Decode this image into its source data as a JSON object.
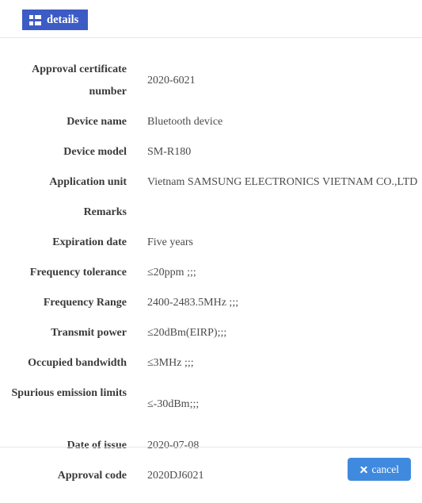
{
  "tab": {
    "label": "details",
    "icon": "grid-icon",
    "active_color": "#3c5bc4"
  },
  "form": {
    "rows": [
      {
        "label": "Approval certificate number",
        "value": "2020-6021",
        "wraps": true
      },
      {
        "label": "Device name",
        "value": "Bluetooth device",
        "wraps": false
      },
      {
        "label": "Device model",
        "value": "SM-R180",
        "wraps": false
      },
      {
        "label": "Application unit",
        "value": "Vietnam SAMSUNG ELECTRONICS VIETNAM CO.,LTD",
        "wraps": false
      },
      {
        "label": "Remarks",
        "value": "",
        "wraps": false
      },
      {
        "label": "Expiration date",
        "value": "Five years",
        "wraps": false
      },
      {
        "label": "Frequency tolerance",
        "value": "≤20ppm ;;;",
        "wraps": false
      },
      {
        "label": "Frequency Range",
        "value": "2400-2483.5MHz ;;;",
        "wraps": false
      },
      {
        "label": "Transmit power",
        "value": "≤20dBm(EIRP);;;",
        "wraps": false
      },
      {
        "label": "Occupied bandwidth",
        "value": "≤3MHz ;;;",
        "wraps": false
      },
      {
        "label": "Spurious emission limits",
        "value": "≤-30dBm;;;",
        "wraps": true
      },
      {
        "label": "Date of issue",
        "value": "2020-07-08",
        "wraps": false
      },
      {
        "label": "Approval code",
        "value": "2020DJ6021",
        "wraps": false
      }
    ]
  },
  "footer": {
    "cancel_label": "cancel",
    "cancel_icon": "close-icon",
    "cancel_color": "#3f8adf"
  }
}
